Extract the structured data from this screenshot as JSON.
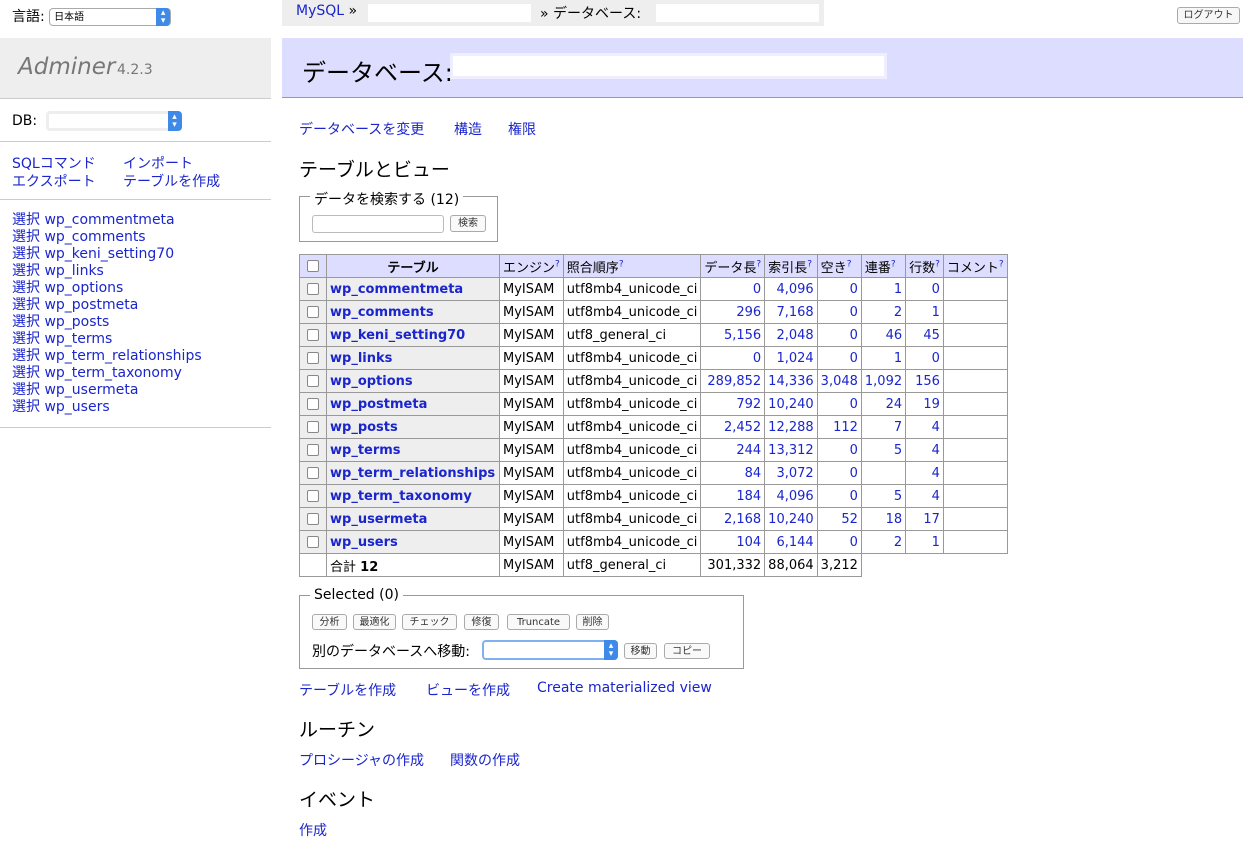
{
  "language": {
    "label": "言語:",
    "selected": "日本語"
  },
  "breadcrumb": {
    "driver": "MySQL",
    "sep1": "»",
    "sep2": "» データベース:"
  },
  "logout": "ログアウト",
  "brand": {
    "name": "Adminer",
    "version": "4.2.3"
  },
  "db_select": {
    "label": "DB:"
  },
  "commands": {
    "sql": "SQLコマンド",
    "import": "インポート",
    "export": "エクスポート",
    "create_table": "テーブルを作成"
  },
  "sidebar_tables": [
    {
      "select": "選択",
      "name": "wp_commentmeta"
    },
    {
      "select": "選択",
      "name": "wp_comments"
    },
    {
      "select": "選択",
      "name": "wp_keni_setting70"
    },
    {
      "select": "選択",
      "name": "wp_links"
    },
    {
      "select": "選択",
      "name": "wp_options"
    },
    {
      "select": "選択",
      "name": "wp_postmeta"
    },
    {
      "select": "選択",
      "name": "wp_posts"
    },
    {
      "select": "選択",
      "name": "wp_terms"
    },
    {
      "select": "選択",
      "name": "wp_term_relationships"
    },
    {
      "select": "選択",
      "name": "wp_term_taxonomy"
    },
    {
      "select": "選択",
      "name": "wp_usermeta"
    },
    {
      "select": "選択",
      "name": "wp_users"
    }
  ],
  "page_heading": "データベース:",
  "topnav": {
    "alter_db": "データベースを変更",
    "schema": "構造",
    "privileges": "権限"
  },
  "tables_views_heading": "テーブルとビュー",
  "search": {
    "legend": "データを検索する (12)",
    "button": "検索"
  },
  "table": {
    "headers": {
      "table": "テーブル",
      "engine": "エンジン",
      "collation": "照合順序",
      "data_length": "データ長",
      "index_length": "索引長",
      "data_free": "空き",
      "auto_increment": "連番",
      "rows": "行数",
      "comment": "コメント"
    },
    "help_mark": "?",
    "rows": [
      {
        "name": "wp_commentmeta",
        "engine": "MyISAM",
        "collation": "utf8mb4_unicode_ci",
        "data": "0",
        "index": "4,096",
        "free": "0",
        "ai": "1",
        "rows": "0"
      },
      {
        "name": "wp_comments",
        "engine": "MyISAM",
        "collation": "utf8mb4_unicode_ci",
        "data": "296",
        "index": "7,168",
        "free": "0",
        "ai": "2",
        "rows": "1"
      },
      {
        "name": "wp_keni_setting70",
        "engine": "MyISAM",
        "collation": "utf8_general_ci",
        "data": "5,156",
        "index": "2,048",
        "free": "0",
        "ai": "46",
        "rows": "45"
      },
      {
        "name": "wp_links",
        "engine": "MyISAM",
        "collation": "utf8mb4_unicode_ci",
        "data": "0",
        "index": "1,024",
        "free": "0",
        "ai": "1",
        "rows": "0"
      },
      {
        "name": "wp_options",
        "engine": "MyISAM",
        "collation": "utf8mb4_unicode_ci",
        "data": "289,852",
        "index": "14,336",
        "free": "3,048",
        "ai": "1,092",
        "rows": "156"
      },
      {
        "name": "wp_postmeta",
        "engine": "MyISAM",
        "collation": "utf8mb4_unicode_ci",
        "data": "792",
        "index": "10,240",
        "free": "0",
        "ai": "24",
        "rows": "19"
      },
      {
        "name": "wp_posts",
        "engine": "MyISAM",
        "collation": "utf8mb4_unicode_ci",
        "data": "2,452",
        "index": "12,288",
        "free": "112",
        "ai": "7",
        "rows": "4"
      },
      {
        "name": "wp_terms",
        "engine": "MyISAM",
        "collation": "utf8mb4_unicode_ci",
        "data": "244",
        "index": "13,312",
        "free": "0",
        "ai": "5",
        "rows": "4"
      },
      {
        "name": "wp_term_relationships",
        "engine": "MyISAM",
        "collation": "utf8mb4_unicode_ci",
        "data": "84",
        "index": "3,072",
        "free": "0",
        "ai": "",
        "rows": "4"
      },
      {
        "name": "wp_term_taxonomy",
        "engine": "MyISAM",
        "collation": "utf8mb4_unicode_ci",
        "data": "184",
        "index": "4,096",
        "free": "0",
        "ai": "5",
        "rows": "4"
      },
      {
        "name": "wp_usermeta",
        "engine": "MyISAM",
        "collation": "utf8mb4_unicode_ci",
        "data": "2,168",
        "index": "10,240",
        "free": "52",
        "ai": "18",
        "rows": "17"
      },
      {
        "name": "wp_users",
        "engine": "MyISAM",
        "collation": "utf8mb4_unicode_ci",
        "data": "104",
        "index": "6,144",
        "free": "0",
        "ai": "2",
        "rows": "1"
      }
    ],
    "total": {
      "label": "合計",
      "count": "12",
      "engine": "MyISAM",
      "collation": "utf8_general_ci",
      "data": "301,332",
      "index": "88,064",
      "free": "3,212"
    }
  },
  "selected": {
    "legend": "Selected (0)",
    "buttons": [
      "分析",
      "最適化",
      "チェック",
      "修復",
      "Truncate",
      "削除"
    ],
    "move_label": "別のデータベースへ移動:",
    "move_button": "移動",
    "copy_button": "コピー"
  },
  "bottom_links": {
    "create_table": "テーブルを作成",
    "create_view": "ビューを作成",
    "create_mview": "Create materialized view"
  },
  "routines": {
    "heading": "ルーチン",
    "procedure": "プロシージャの作成",
    "function": "関数の作成"
  },
  "events": {
    "heading": "イベント",
    "create": "作成"
  }
}
